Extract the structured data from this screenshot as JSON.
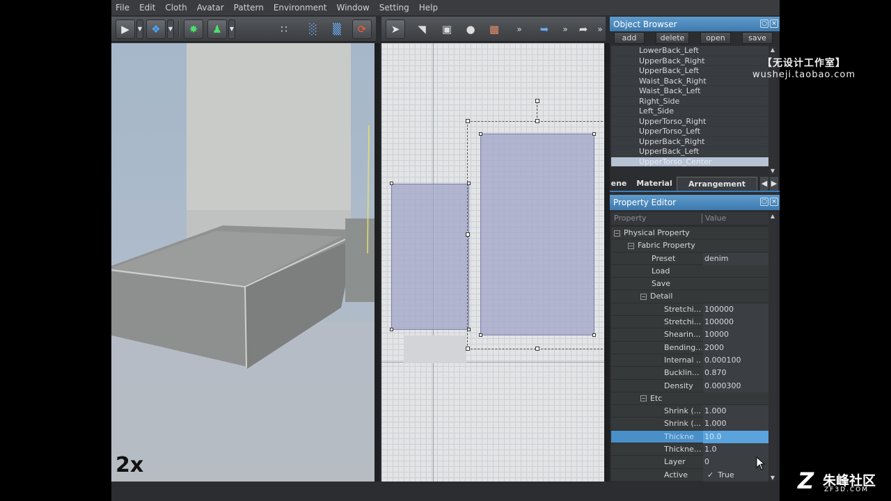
{
  "menu": [
    "File",
    "Edit",
    "Cloth",
    "Avatar",
    "Pattern",
    "Environment",
    "Window",
    "Setting",
    "Help"
  ],
  "viewport3d": {
    "zoom_label": "2x"
  },
  "object_browser": {
    "title": "Object Browser",
    "buttons": {
      "add": "add",
      "delete": "delete",
      "open": "open",
      "save": "save"
    },
    "items": [
      "LowerBack_Left",
      "UpperBack_Right",
      "UpperBack_Left",
      "Waist_Back_Right",
      "Waist_Back_Left",
      "Right_Side",
      "Left_Side",
      "UpperTorso_Right",
      "UpperTorso_Left",
      "UpperBack_Right",
      "UpperBack_Left",
      "UpperTorso_Center"
    ],
    "selected_index": 11
  },
  "tabs": [
    "ene",
    "Material",
    "Arrangement Point"
  ],
  "property_editor": {
    "title": "Property Editor",
    "header": {
      "property": "Property",
      "value": "Value"
    },
    "rows": [
      {
        "name": "Physical Property",
        "value": ""
      },
      {
        "name": "Fabric Property",
        "value": ""
      },
      {
        "name": "Preset",
        "value": "denim"
      },
      {
        "name": "Load",
        "value": ""
      },
      {
        "name": "Save",
        "value": ""
      },
      {
        "name": "Detail",
        "value": ""
      },
      {
        "name": "Stretchi...",
        "value": "100000"
      },
      {
        "name": "Stretchi...",
        "value": "100000"
      },
      {
        "name": "Shearin...",
        "value": "10000"
      },
      {
        "name": "Bending...",
        "value": "2000"
      },
      {
        "name": "Internal ...",
        "value": "0.000100"
      },
      {
        "name": "Bucklin...",
        "value": "0.870"
      },
      {
        "name": "Density",
        "value": "0.000300"
      },
      {
        "name": "Etc",
        "value": ""
      },
      {
        "name": "Shrink (...",
        "value": "1.000"
      },
      {
        "name": "Shrink (...",
        "value": "1.000"
      },
      {
        "name": "Thickne",
        "value": "10.0"
      },
      {
        "name": "Thickne...",
        "value": "1.0"
      },
      {
        "name": "Layer",
        "value": "0"
      },
      {
        "name": "Active",
        "value": "True"
      }
    ]
  },
  "watermark_top": {
    "line1": "【无设计工作室】",
    "line2": "wusheji.taobao.com"
  },
  "watermark_bottom": {
    "line1": "朱峰社区",
    "line2": "ZF3D.COM"
  }
}
